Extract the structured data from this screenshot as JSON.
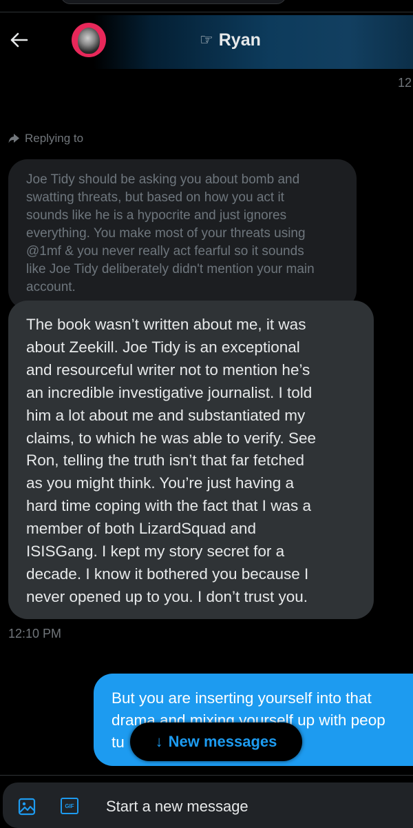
{
  "header": {
    "back_label": "←",
    "contact_prefix_glyph": "☞",
    "contact_name": "Ryan"
  },
  "edge_timestamp": "12",
  "reply": {
    "label": "Replying to",
    "quoted_text": "Joe Tidy should be asking you about bomb and\nswatting threats, but based on how you act it\nsounds like he is a hypocrite and just ignores\neverything.  You make most of your threats using\n@1mf & you never really act fearful so it sounds\nlike Joe Tidy deliberately didn't mention your main\naccount."
  },
  "messages": [
    {
      "direction": "incoming",
      "text": "The book wasn’t written about me, it was\nabout Zeekill. Joe Tidy is an exceptional\nand resourceful writer not to mention he’s\nan incredible investigative journalist. I told\nhim a lot about me and substantiated my\nclaims, to which he was able to verify. See\nRon, telling the truth isn’t that far fetched\nas you might think. You’re just having a\nhard time coping with the fact that I was a\nmember of both LizardSquad and\nISISGang. I kept my story secret for a\ndecade. I know it bothered you because I\nnever opened up to you. I don’t trust you.",
      "time": "12:10 PM"
    },
    {
      "direction": "outgoing",
      "text": "But you are inserting yourself into that\ndrama and mixing yourself up with peop\ntu"
    }
  ],
  "new_messages_button": {
    "arrow": "↓",
    "label": "New messages"
  },
  "composer": {
    "placeholder": "Start a new message",
    "gif_label": "GIF"
  },
  "colors": {
    "accent": "#1d9bf0",
    "background": "#000000",
    "incoming_bubble": "#2f3336",
    "quoted_bubble": "#1c1e21",
    "muted_text": "#71767b",
    "avatar_ring": "#e8285a"
  },
  "icons": {
    "back": "arrow-left-icon",
    "reply": "reply-arrow-icon",
    "media": "image-icon",
    "gif": "gif-icon"
  }
}
